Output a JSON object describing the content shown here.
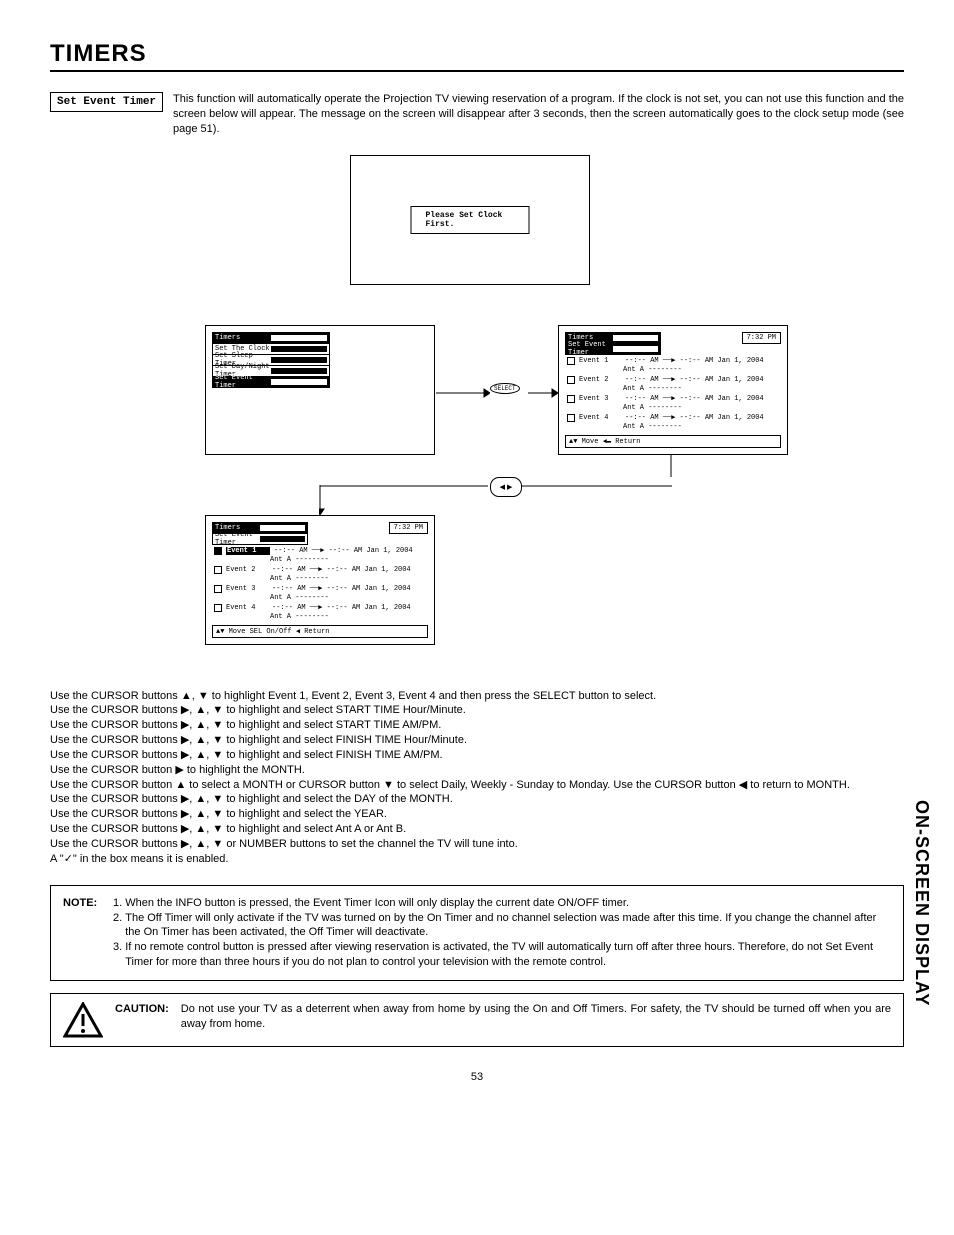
{
  "page_title": "TIMERS",
  "side_tab": "ON-SCREEN DISPLAY",
  "page_number": "53",
  "section_label": "Set Event Timer",
  "intro": "This function will automatically operate the Projection TV viewing reservation of a program.  If the clock is not set, you can not use this function and the screen below will appear.  The message on the screen will disappear after 3 seconds, then the screen automatically goes to the clock setup mode (see page 51).",
  "msg_box": "Please Set Clock First.",
  "select_label": "SELECT",
  "menu1": {
    "title": "Timers",
    "items": [
      "Set The Clock",
      "Set Sleep Timer",
      "Set Day/Night Timer",
      "Set Event Timer"
    ]
  },
  "clock": "7:32 PM",
  "event_header": {
    "title": "Timers",
    "sub": "Set Event Timer"
  },
  "events": {
    "rows": [
      {
        "name": "Event 1",
        "line": "--:-- AM ──▶ --:-- AM  Jan 1, 2004",
        "sub": "Ant A --------"
      },
      {
        "name": "Event 2",
        "line": "--:-- AM ──▶ --:-- AM  Jan 1, 2004",
        "sub": "Ant A --------"
      },
      {
        "name": "Event 3",
        "line": "--:-- AM ──▶ --:-- AM  Jan 1, 2004",
        "sub": "Ant A --------"
      },
      {
        "name": "Event 4",
        "line": "--:-- AM ──▶ --:-- AM  Jan 1, 2004",
        "sub": "Ant A --------"
      }
    ],
    "foot_right": "▲▼ Move  ◀▬ Return",
    "foot_bottom": "▲▼ Move  SEL On/Off  ◀ Return"
  },
  "instructions": [
    "Use the CURSOR buttons ▲, ▼ to highlight Event 1, Event 2, Event 3, Event 4 and then press the SELECT button to select.",
    "Use the CURSOR buttons ▶, ▲, ▼ to highlight and select START TIME Hour/Minute.",
    "Use the CURSOR buttons ▶, ▲, ▼ to highlight and select START TIME AM/PM.",
    "Use the CURSOR buttons ▶, ▲, ▼ to highlight and select FINISH TIME Hour/Minute.",
    "Use the CURSOR buttons ▶, ▲, ▼ to highlight and select FINISH TIME AM/PM.",
    "Use the CURSOR button ▶ to highlight the MONTH.",
    "Use the CURSOR button ▲ to select a MONTH or CURSOR button ▼ to select Daily, Weekly - Sunday to Monday.  Use the CURSOR button ◀ to return to MONTH.",
    "Use the CURSOR buttons ▶, ▲, ▼ to highlight and select the DAY of the MONTH.",
    "Use the CURSOR buttons ▶, ▲, ▼ to highlight and select the YEAR.",
    "Use the CURSOR buttons ▶, ▲, ▼ to highlight and select Ant A or Ant B.",
    "Use the CURSOR buttons ▶, ▲, ▼ or NUMBER buttons to set the channel the TV will tune into.",
    "A \"✓\" in the box means it is enabled."
  ],
  "note": {
    "label": "NOTE:",
    "items": [
      "When the INFO button is pressed, the Event Timer Icon will only display the current date ON/OFF timer.",
      "The Off Timer will only activate if the TV was turned on by the On Timer and no channel selection was made after this time.  If you change the channel after the On Timer has been activated, the Off Timer will deactivate.",
      "If no remote control button is pressed after viewing reservation is activated, the TV will automatically turn off after three hours.  Therefore, do not Set Event Timer for more than three hours if you do not plan to control your television with the remote control."
    ]
  },
  "caution": {
    "label": "CAUTION:",
    "text": "Do not use your TV as a deterrent when away from home by using the On and Off Timers.  For safety, the TV should be turned off when you are away from home."
  }
}
